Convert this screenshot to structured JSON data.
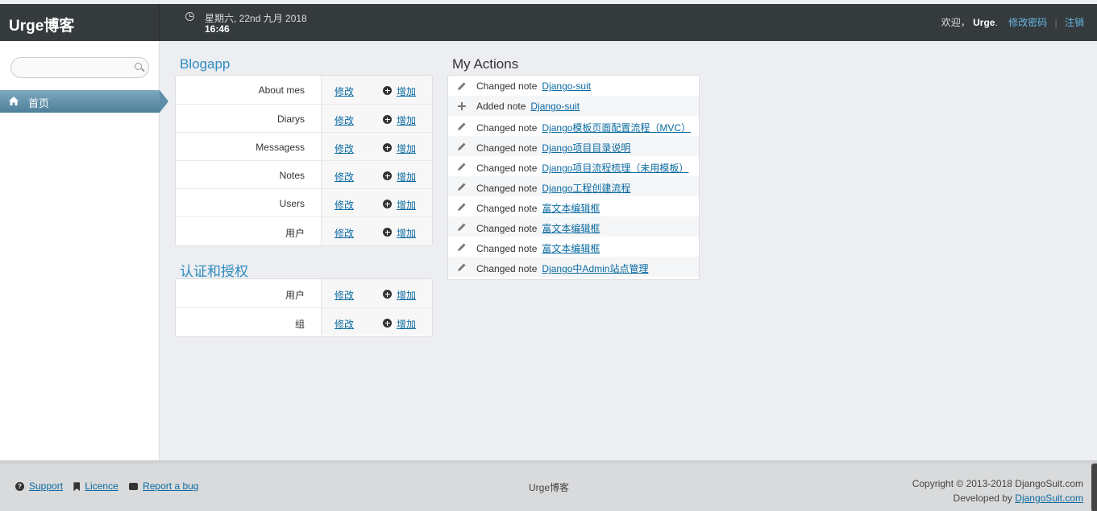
{
  "header": {
    "brand": "Urge博客",
    "date": "星期六, 22nd 九月 2018",
    "time": "16:46",
    "welcome": "欢迎，",
    "username": "Urge",
    "period": ".",
    "change_password": "修改密码",
    "separator": "|",
    "logout": "注销"
  },
  "sidebar": {
    "search_placeholder": "",
    "home_label": "首页"
  },
  "modules": [
    {
      "title": "Blogapp",
      "rows": [
        {
          "name": "About mes",
          "change": "修改",
          "add": "增加"
        },
        {
          "name": "Diarys",
          "change": "修改",
          "add": "增加"
        },
        {
          "name": "Messagess",
          "change": "修改",
          "add": "增加"
        },
        {
          "name": "Notes",
          "change": "修改",
          "add": "增加"
        },
        {
          "name": "Users",
          "change": "修改",
          "add": "增加"
        },
        {
          "name": "用户",
          "change": "修改",
          "add": "增加"
        }
      ]
    },
    {
      "title": "认证和授权",
      "rows": [
        {
          "name": "用户",
          "change": "修改",
          "add": "增加"
        },
        {
          "name": "组",
          "change": "修改",
          "add": "增加"
        }
      ]
    }
  ],
  "actions": {
    "title": "My Actions",
    "items": [
      {
        "icon": "pencil-icon",
        "verb": "Changed note",
        "link": "Django-suit"
      },
      {
        "icon": "plus-icon",
        "verb": "Added note",
        "link": "Django-suit"
      },
      {
        "icon": "pencil-icon",
        "verb": "Changed note",
        "link": "Django模板页面配置流程（MVC）"
      },
      {
        "icon": "pencil-icon",
        "verb": "Changed note",
        "link": "Django项目目录说明"
      },
      {
        "icon": "pencil-icon",
        "verb": "Changed note",
        "link": "Django项目流程梳理（未用模板）"
      },
      {
        "icon": "pencil-icon",
        "verb": "Changed note",
        "link": "Django工程创建流程"
      },
      {
        "icon": "pencil-icon",
        "verb": "Changed note",
        "link": "富文本编辑框"
      },
      {
        "icon": "pencil-icon",
        "verb": "Changed note",
        "link": "富文本编辑框"
      },
      {
        "icon": "pencil-icon",
        "verb": "Changed note",
        "link": "富文本编辑框"
      },
      {
        "icon": "pencil-icon",
        "verb": "Changed note",
        "link": "Django中Admin站点管理"
      }
    ]
  },
  "footer": {
    "support": "Support",
    "licence": "Licence",
    "report_bug": "Report a bug",
    "center": "Urge博客",
    "copyright": "Copyright © 2013-2018 DjangoSuit.com",
    "developed_by": "Developed by",
    "developer_link": "DjangoSuit.com"
  },
  "colors": {
    "header_bg": "#353a3d",
    "link": "#0a6aa1",
    "module_title": "#2f8bc0",
    "nav_active": "#5f8fa8"
  }
}
